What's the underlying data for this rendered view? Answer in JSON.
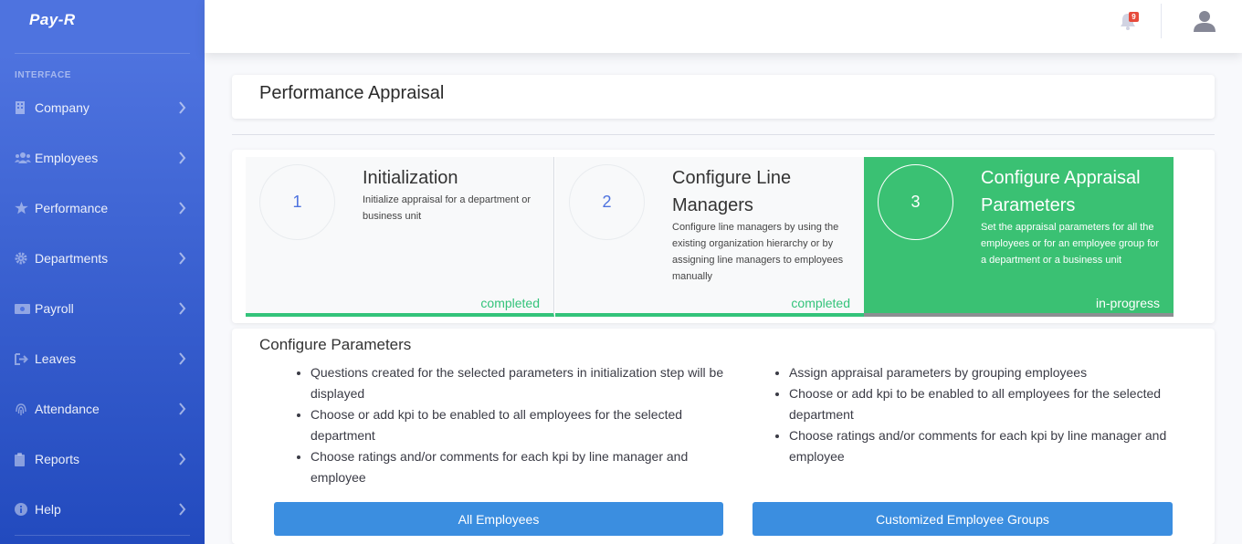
{
  "app": {
    "brand": "Pay-R"
  },
  "sidebar": {
    "heading": "INTERFACE",
    "items": [
      {
        "label": "Company",
        "icon": "building-icon"
      },
      {
        "label": "Employees",
        "icon": "users-icon"
      },
      {
        "label": "Performance",
        "icon": "star-icon"
      },
      {
        "label": "Departments",
        "icon": "gear-icon"
      },
      {
        "label": "Payroll",
        "icon": "money-icon"
      },
      {
        "label": "Leaves",
        "icon": "sign-out-icon"
      },
      {
        "label": "Attendance",
        "icon": "fingerprint-icon"
      },
      {
        "label": "Reports",
        "icon": "clipboard-icon"
      },
      {
        "label": "Help",
        "icon": "info-icon"
      }
    ]
  },
  "topbar": {
    "notification_count": "9"
  },
  "page": {
    "title": "Performance Appraisal"
  },
  "steps": [
    {
      "number": "1",
      "title": "Initialization",
      "description": "Initialize appraisal for a department or business unit",
      "status": "completed"
    },
    {
      "number": "2",
      "title": "Configure Line Managers",
      "description": "Configure line managers by using the existing organization hierarchy or by assigning line managers to employees manually",
      "status": "completed"
    },
    {
      "number": "3",
      "title": "Configure Appraisal Parameters",
      "description": "Set the appraisal parameters for all the employees or for an employee group for a department or a business unit",
      "status": "in-progress"
    }
  ],
  "parameters": {
    "title": "Configure Parameters",
    "left_items": [
      "Questions created for the selected parameters in initialization step will be displayed",
      "Choose or add kpi to be enabled to all employees for the selected department",
      "Choose ratings and/or comments for each kpi by line manager and employee"
    ],
    "right_items": [
      "Assign appraisal parameters by grouping employees",
      "Choose or add kpi to be enabled to all employees for the selected department",
      "Choose ratings and/or comments for each kpi by line manager and employee"
    ],
    "all_employees_label": "All Employees",
    "custom_groups_label": "Customized Employee Groups"
  },
  "colors": {
    "sidebar_top": "#4e73df",
    "sidebar_bottom": "#224abe",
    "success": "#3ac173",
    "button": "#3b8ee0",
    "badge": "#e74a3b"
  }
}
